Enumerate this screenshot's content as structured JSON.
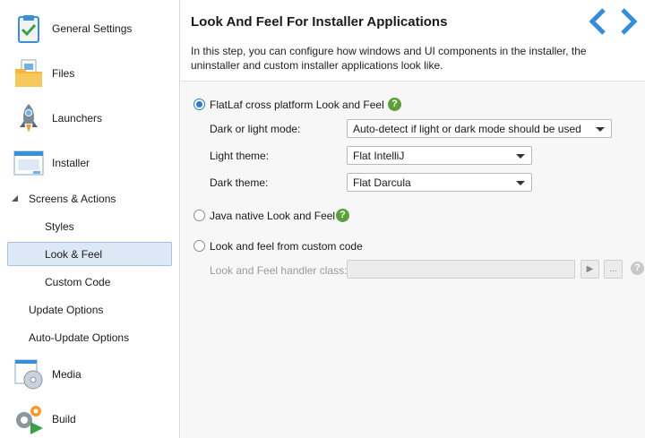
{
  "sidebar": {
    "items": [
      {
        "label": "General Settings",
        "icon": "clipboard-check-icon"
      },
      {
        "label": "Files",
        "icon": "folder-files-icon"
      },
      {
        "label": "Launchers",
        "icon": "rocket-icon"
      },
      {
        "label": "Installer",
        "icon": "installer-window-icon"
      },
      {
        "label": "Screens & Actions",
        "icon": "collapse-triangle-icon"
      },
      {
        "label": "Styles"
      },
      {
        "label": "Look & Feel"
      },
      {
        "label": "Custom Code"
      },
      {
        "label": "Update Options"
      },
      {
        "label": "Auto-Update Options"
      },
      {
        "label": "Media",
        "icon": "media-disc-icon"
      },
      {
        "label": "Build",
        "icon": "build-gears-icon"
      }
    ],
    "selected": "Look & Feel"
  },
  "header": {
    "title": "Look And Feel For Installer Applications",
    "description": "In this step, you can configure how windows and UI components in the installer, the uninstaller and custom installer applications look like.",
    "back_icon": "chevron-left-icon",
    "forward_icon": "chevron-right-icon"
  },
  "options": {
    "flatlaf": {
      "label": "FlatLaf cross platform Look and Feel",
      "selected": true,
      "help": "?",
      "mode_label": "Dark or light mode:",
      "mode_value": "Auto-detect if light or dark mode should be used",
      "light_label": "Light theme:",
      "light_value": "Flat IntelliJ",
      "dark_label": "Dark theme:",
      "dark_value": "Flat Darcula"
    },
    "native": {
      "label": "Java native Look and Feel",
      "selected": false,
      "help": "?"
    },
    "custom": {
      "label": "Look and feel from custom code",
      "selected": false,
      "handler_label": "Look and Feel handler class:",
      "handler_value": "",
      "run_icon": "play-icon",
      "more_label": "...",
      "help": "?"
    }
  },
  "colors": {
    "accent": "#2a7cd3",
    "help_green": "#5aa13a",
    "selection": "#dce8f5",
    "nav_arrow": "#2f8ee0"
  }
}
